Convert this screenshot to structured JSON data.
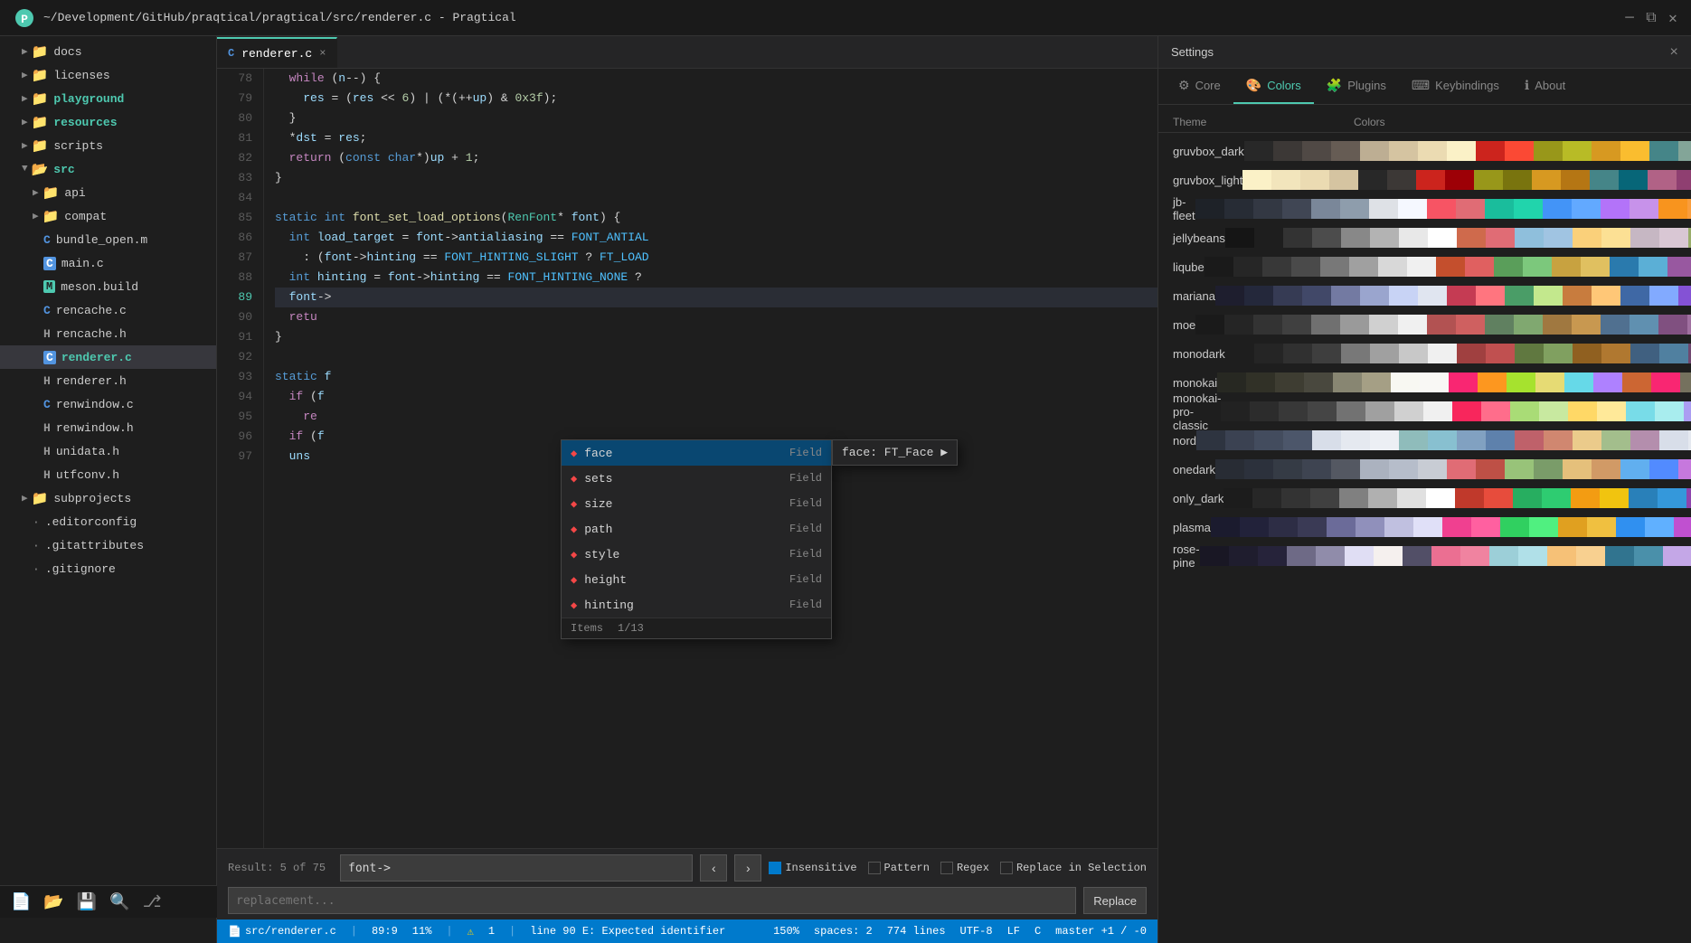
{
  "titlebar": {
    "title": "~/Development/GitHub/praqtical/pragtical/src/renderer.c - Pragtical",
    "icon": "P"
  },
  "sidebar": {
    "items": [
      {
        "id": "docs",
        "label": "docs",
        "type": "folder",
        "indent": 1,
        "collapsed": true
      },
      {
        "id": "licenses",
        "label": "licenses",
        "type": "folder",
        "indent": 1,
        "collapsed": true
      },
      {
        "id": "playground",
        "label": "playground",
        "type": "folder",
        "indent": 1,
        "collapsed": true,
        "highlight": true
      },
      {
        "id": "resources",
        "label": "resources",
        "type": "folder",
        "indent": 1,
        "collapsed": true,
        "highlight": true
      },
      {
        "id": "scripts",
        "label": "scripts",
        "type": "folder",
        "indent": 1,
        "collapsed": true
      },
      {
        "id": "src",
        "label": "src",
        "type": "folder",
        "indent": 1,
        "open": true
      },
      {
        "id": "api",
        "label": "api",
        "type": "folder",
        "indent": 2,
        "collapsed": true
      },
      {
        "id": "compat",
        "label": "compat",
        "type": "folder",
        "indent": 2,
        "collapsed": true
      },
      {
        "id": "bundle_open",
        "label": "bundle_open.m",
        "type": "file-c",
        "indent": 2
      },
      {
        "id": "main",
        "label": "main.c",
        "type": "file-c",
        "indent": 2,
        "active": true
      },
      {
        "id": "meson_build",
        "label": "meson.build",
        "type": "file-build",
        "indent": 2
      },
      {
        "id": "rencache_c",
        "label": "rencache.c",
        "type": "file-c",
        "indent": 2
      },
      {
        "id": "rencache_h",
        "label": "rencache.h",
        "type": "file-h",
        "indent": 2
      },
      {
        "id": "renderer_c",
        "label": "renderer.c",
        "type": "file-c",
        "indent": 2,
        "selected": true
      },
      {
        "id": "renderer_h",
        "label": "renderer.h",
        "type": "file-h",
        "indent": 2
      },
      {
        "id": "renwindow_c",
        "label": "renwindow.c",
        "type": "file-c",
        "indent": 2
      },
      {
        "id": "renwindow_h",
        "label": "renwindow.h",
        "type": "file-h",
        "indent": 2
      },
      {
        "id": "unidata_h",
        "label": "unidata.h",
        "type": "file-h",
        "indent": 2
      },
      {
        "id": "utfconv_h",
        "label": "utfconv.h",
        "type": "file-h",
        "indent": 2
      },
      {
        "id": "subprojects",
        "label": "subprojects",
        "type": "folder",
        "indent": 1,
        "collapsed": true
      },
      {
        "id": "editorconfig",
        "label": ".editorconfig",
        "type": "file-generic",
        "indent": 1
      },
      {
        "id": "gitattributes",
        "label": ".gitattributes",
        "type": "file-generic",
        "indent": 1
      },
      {
        "id": "gitignore",
        "label": ".gitignore",
        "type": "file-generic",
        "indent": 1
      }
    ]
  },
  "tab": {
    "filename": "renderer.c",
    "close_label": "×"
  },
  "code": {
    "lines": [
      {
        "num": 78,
        "content": "  while (n--) {"
      },
      {
        "num": 79,
        "content": "    res = (res << 6) | (*(++up) & 0x3f);"
      },
      {
        "num": 80,
        "content": "  }"
      },
      {
        "num": 81,
        "content": "  *dst = res;"
      },
      {
        "num": 82,
        "content": "  return (const char*)up + 1;"
      },
      {
        "num": 83,
        "content": "}"
      },
      {
        "num": 84,
        "content": ""
      },
      {
        "num": 85,
        "content": "static int font_set_load_options(RenFont* font) {"
      },
      {
        "num": 86,
        "content": "  int load_target = font->antialiasing == FONT_ANTIAL"
      },
      {
        "num": 87,
        "content": "    : (font->hinting == FONT_HINTING_SLIGHT ? FT_LOAD"
      },
      {
        "num": 88,
        "content": "  int hinting = font->hinting == FONT_HINTING_NONE ?"
      },
      {
        "num": 89,
        "content": "  font->"
      },
      {
        "num": 90,
        "content": "  retu"
      },
      {
        "num": 91,
        "content": "}"
      },
      {
        "num": 92,
        "content": ""
      },
      {
        "num": 93,
        "content": "static f"
      },
      {
        "num": 94,
        "content": "  if (f"
      },
      {
        "num": 95,
        "content": "    re"
      },
      {
        "num": 96,
        "content": "  if (f"
      },
      {
        "num": 97,
        "content": "  uns"
      }
    ]
  },
  "autocomplete": {
    "items": [
      {
        "label": "face",
        "type": "Field"
      },
      {
        "label": "sets",
        "type": "Field"
      },
      {
        "label": "size",
        "type": "Field"
      },
      {
        "label": "path",
        "type": "Field"
      },
      {
        "label": "style",
        "type": "Field"
      },
      {
        "label": "height",
        "type": "Field"
      },
      {
        "label": "hinting",
        "type": "Field"
      }
    ],
    "count": "1/13",
    "items_label": "Items",
    "tooltip": "face: FT_Face  ▶"
  },
  "find_bar": {
    "search_value": "font->",
    "search_placeholder": "",
    "replace_placeholder": "replacement...",
    "result": "Result: 5 of 75",
    "options": {
      "insensitive": {
        "label": "Insensitive",
        "checked": true
      },
      "pattern": {
        "label": "Pattern",
        "checked": false
      },
      "regex": {
        "label": "Regex",
        "checked": false
      },
      "replace_in_selection": {
        "label": "Replace in Selection",
        "checked": false
      }
    },
    "prev_label": "‹",
    "next_label": "›",
    "replace_label": "Replace"
  },
  "settings": {
    "title": "Settings",
    "close_label": "×",
    "tabs": [
      {
        "id": "core",
        "label": "Core",
        "icon": "⚙"
      },
      {
        "id": "colors",
        "label": "Colors",
        "icon": "🎨"
      },
      {
        "id": "plugins",
        "label": "Plugins",
        "icon": "🧩"
      },
      {
        "id": "keybindings",
        "label": "Keybindings",
        "icon": "⌨"
      },
      {
        "id": "about",
        "label": "About",
        "icon": "ℹ"
      }
    ],
    "active_tab": "colors",
    "theme_header": {
      "name": "Theme",
      "colors": "Colors"
    },
    "themes": [
      {
        "name": "gruvbox_dark",
        "swatches": [
          "#282828",
          "#3c3836",
          "#504945",
          "#665c54",
          "#bdae93",
          "#d5c4a1",
          "#ebdbb2",
          "#fbf1c7",
          "#cc241d",
          "#fb4934",
          "#98971a",
          "#b8bb26",
          "#d79921",
          "#fabd2f",
          "#458588",
          "#83a598",
          "#b16286",
          "#d3869b",
          "#689d6a",
          "#8ec07c"
        ]
      },
      {
        "name": "gruvbox_light",
        "swatches": [
          "#fbf1c7",
          "#f2e5bc",
          "#ebdbb2",
          "#d5c4a1",
          "#282828",
          "#3c3836",
          "#cc241d",
          "#9d0006",
          "#98971a",
          "#79740e",
          "#d79921",
          "#b57614",
          "#458588",
          "#076678",
          "#b16286",
          "#8f3f71",
          "#689d6a",
          "#427b58",
          "#7c6f64",
          "#bdae93"
        ]
      },
      {
        "name": "jb-fleet",
        "swatches": [
          "#1e2228",
          "#272c35",
          "#333843",
          "#404654",
          "#7a8799",
          "#8e9dac",
          "#dee1e6",
          "#f5f8ff",
          "#f75464",
          "#e06c75",
          "#1abd9c",
          "#21d4ac",
          "#4394f7",
          "#62a9ff",
          "#b373f9",
          "#c792ea",
          "#f8941e",
          "#f99d3c",
          "#6bcafb",
          "#94d9ff"
        ]
      },
      {
        "name": "jellybeans",
        "swatches": [
          "#151515",
          "#1e1e1e",
          "#333333",
          "#4c4c4c",
          "#888888",
          "#b3b3b3",
          "#e8e8e8",
          "#ffffff",
          "#cf6a4c",
          "#e06c75",
          "#8fbfdc",
          "#a0c4e2",
          "#fad07a",
          "#fce094",
          "#c6b7c3",
          "#d9c7d4",
          "#99ad6a",
          "#b5ce87",
          "#d4c9e4",
          "#8fa2c6"
        ]
      },
      {
        "name": "liqube",
        "swatches": [
          "#1a1a1a",
          "#262626",
          "#383838",
          "#4a4a4a",
          "#787878",
          "#a0a0a0",
          "#d8d8d8",
          "#f0f0f0",
          "#c44f2d",
          "#e06060",
          "#5a9e5a",
          "#7cc87c",
          "#c8a240",
          "#e0c060",
          "#2a7aad",
          "#5bafd6",
          "#9858a0",
          "#c07cc8",
          "#3a9070",
          "#5cb890"
        ]
      },
      {
        "name": "mariana",
        "swatches": [
          "#1e1e2e",
          "#24283b",
          "#363b54",
          "#414868",
          "#737aa2",
          "#9aa5ce",
          "#c8d3f5",
          "#e0e5f0",
          "#c53b53",
          "#ff757f",
          "#4a9d67",
          "#c3e88d",
          "#c87c3e",
          "#ffc777",
          "#3f68a5",
          "#82aaff",
          "#8452d5",
          "#c099ff",
          "#346369",
          "#86e1fc"
        ]
      },
      {
        "name": "moe",
        "swatches": [
          "#1a1a1a",
          "#252525",
          "#333333",
          "#404040",
          "#707070",
          "#9a9a9a",
          "#d0d0d0",
          "#f0f0f0",
          "#b25252",
          "#cf6060",
          "#608060",
          "#80a870",
          "#a07840",
          "#c89850",
          "#507090",
          "#6090b0",
          "#805080",
          "#a070a0",
          "#508080",
          "#70a0a0"
        ]
      },
      {
        "name": "monodark",
        "swatches": [
          "#1e1e1e",
          "#252525",
          "#303030",
          "#3e3e3e",
          "#787878",
          "#a0a0a0",
          "#c8c8c8",
          "#f0f0f0",
          "#a04040",
          "#c05050",
          "#607840",
          "#80a060",
          "#906020",
          "#b07830",
          "#406080",
          "#5080a0",
          "#704870",
          "#906890",
          "#408070",
          "#60a090"
        ]
      },
      {
        "name": "monokai",
        "swatches": [
          "#272822",
          "#313127",
          "#3e3d32",
          "#49483e",
          "#888672",
          "#a59f85",
          "#f8f8f2",
          "#f9f8f5",
          "#f92672",
          "#fd971f",
          "#a6e22e",
          "#e6db74",
          "#66d9e8",
          "#ae81ff",
          "#cc6633",
          "#f92672",
          "#75715e",
          "#e69f66",
          "#46a6c0",
          "#8ec07c"
        ]
      },
      {
        "name": "monokai-pro-classic",
        "swatches": [
          "#222222",
          "#2c2c2c",
          "#383838",
          "#454545",
          "#727272",
          "#a0a0a0",
          "#d0d0d0",
          "#f0f0f0",
          "#f8265c",
          "#ff6d8b",
          "#a9dc76",
          "#c8e9a0",
          "#ffd866",
          "#ffe999",
          "#78dce8",
          "#a8edee",
          "#ab9df2",
          "#c8bcf6",
          "#fc9867",
          "#fdb99a"
        ]
      },
      {
        "name": "nord",
        "swatches": [
          "#2e3440",
          "#3b4252",
          "#434c5e",
          "#4c566a",
          "#d8dee9",
          "#e5e9f0",
          "#eceff4",
          "#8fbcbb",
          "#88c0d0",
          "#81a1c1",
          "#5e81ac",
          "#bf616a",
          "#d08770",
          "#ebcb8b",
          "#a3be8c",
          "#b48ead",
          "#d8dee9",
          "#e5e9f0",
          "#434c5e",
          "#4c566a"
        ]
      },
      {
        "name": "onedark",
        "swatches": [
          "#282c34",
          "#2c313c",
          "#353b45",
          "#3e4451",
          "#545862",
          "#abb2bf",
          "#b6bdca",
          "#c8ccd4",
          "#e06c75",
          "#be5046",
          "#98c379",
          "#7a9c69",
          "#e5c07b",
          "#d19a66",
          "#61afef",
          "#528bff",
          "#c678dd",
          "#a626a4",
          "#56b6c2",
          "#2bbac5"
        ]
      },
      {
        "name": "only_dark",
        "swatches": [
          "#1c1c1c",
          "#272727",
          "#333333",
          "#404040",
          "#808080",
          "#b0b0b0",
          "#e0e0e0",
          "#ffffff",
          "#c0392b",
          "#e74c3c",
          "#27ae60",
          "#2ecc71",
          "#f39c12",
          "#f1c40f",
          "#2980b9",
          "#3498db",
          "#8e44ad",
          "#9b59b6",
          "#16a085",
          "#1abc9c"
        ]
      },
      {
        "name": "plasma",
        "swatches": [
          "#1b1b2e",
          "#22223a",
          "#2d2d45",
          "#3a3a55",
          "#6b6b99",
          "#9090bb",
          "#c0c0e0",
          "#e0e0f8",
          "#f04090",
          "#ff60a0",
          "#30d060",
          "#50f080",
          "#e0a020",
          "#f0c040",
          "#3090f0",
          "#60b0ff",
          "#c050d0",
          "#e070e0",
          "#20c0c0",
          "#40e0e0"
        ]
      },
      {
        "name": "rose-pine",
        "swatches": [
          "#191724",
          "#1f1d2e",
          "#26233a",
          "#6e6a86",
          "#908caa",
          "#e0def4",
          "#f5f0ee",
          "#524f67",
          "#eb6f92",
          "#f083a0",
          "#9ccfd8",
          "#b0e0e8",
          "#f6c177",
          "#f8d090",
          "#31748f",
          "#4a90aa",
          "#c4a7e7",
          "#d4b8f0",
          "#ebbcba",
          "#f0cdc8"
        ]
      }
    ]
  },
  "status_bar": {
    "file_icon": "📄",
    "filepath": "src/renderer.c",
    "position": "89:9",
    "percent": "11%",
    "divider": "|",
    "message": "line 90 E: Expected identifier",
    "zoom": "150%",
    "warning_count": "1",
    "spaces": "spaces: 2",
    "lines": "774 lines",
    "encoding": "UTF-8",
    "line_ending": "LF",
    "language": "C",
    "branch": "master +1 / -0"
  },
  "bottom_toolbar": {
    "icons": [
      "new-file",
      "open-file",
      "save-file",
      "search",
      "git"
    ]
  }
}
